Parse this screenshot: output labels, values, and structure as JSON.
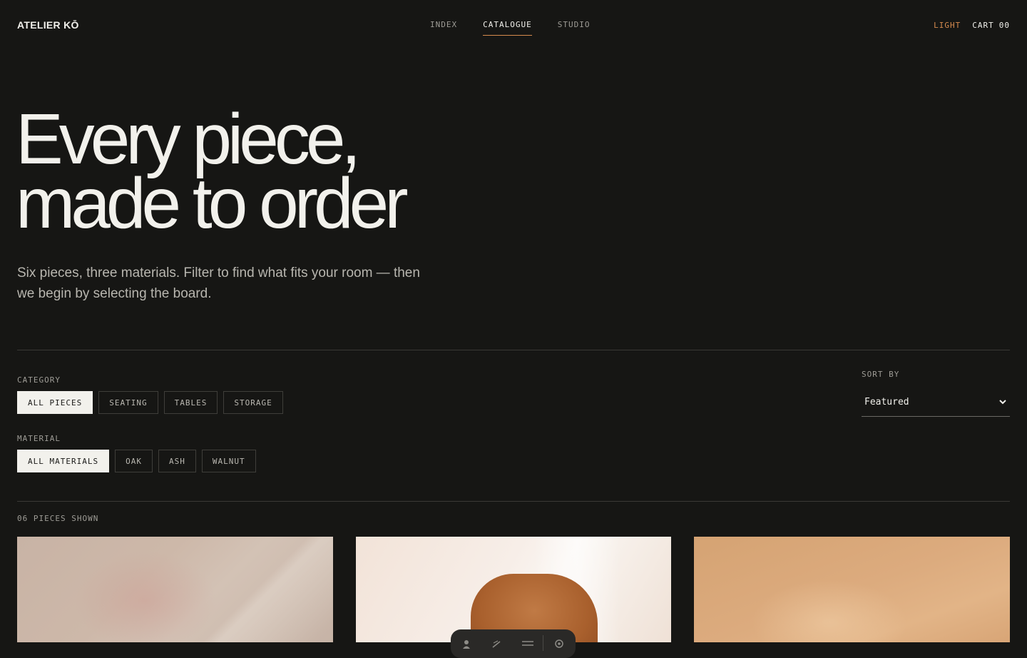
{
  "header": {
    "logo": "ATELIER KŌ",
    "nav": [
      {
        "label": "INDEX"
      },
      {
        "label": "CATALOGUE"
      },
      {
        "label": "STUDIO"
      }
    ],
    "theme_toggle": "LIGHT",
    "cart_label": "CART",
    "cart_count": "00"
  },
  "hero": {
    "title_line1": "Every piece,",
    "title_line2": "made to order",
    "subtitle": "Six pieces, three materials. Filter to find what fits your room — then we begin by selecting the board."
  },
  "filters": {
    "category_label": "CATEGORY",
    "categories": [
      {
        "label": "ALL PIECES",
        "active": true
      },
      {
        "label": "SEATING",
        "active": false
      },
      {
        "label": "TABLES",
        "active": false
      },
      {
        "label": "STORAGE",
        "active": false
      }
    ],
    "material_label": "MATERIAL",
    "materials": [
      {
        "label": "ALL MATERIALS",
        "active": true
      },
      {
        "label": "OAK",
        "active": false
      },
      {
        "label": "ASH",
        "active": false
      },
      {
        "label": "WALNUT",
        "active": false
      }
    ],
    "sort_label": "SORT BY",
    "sort_value": "Featured"
  },
  "results": {
    "count_text": "06 PIECES SHOWN"
  },
  "toolbar": {
    "icons": [
      "person-icon",
      "brush-icon",
      "menu-icon",
      "gear-icon"
    ]
  },
  "colors": {
    "background": "#161614",
    "accent": "#d68b4e",
    "text": "#f2f1ec"
  }
}
